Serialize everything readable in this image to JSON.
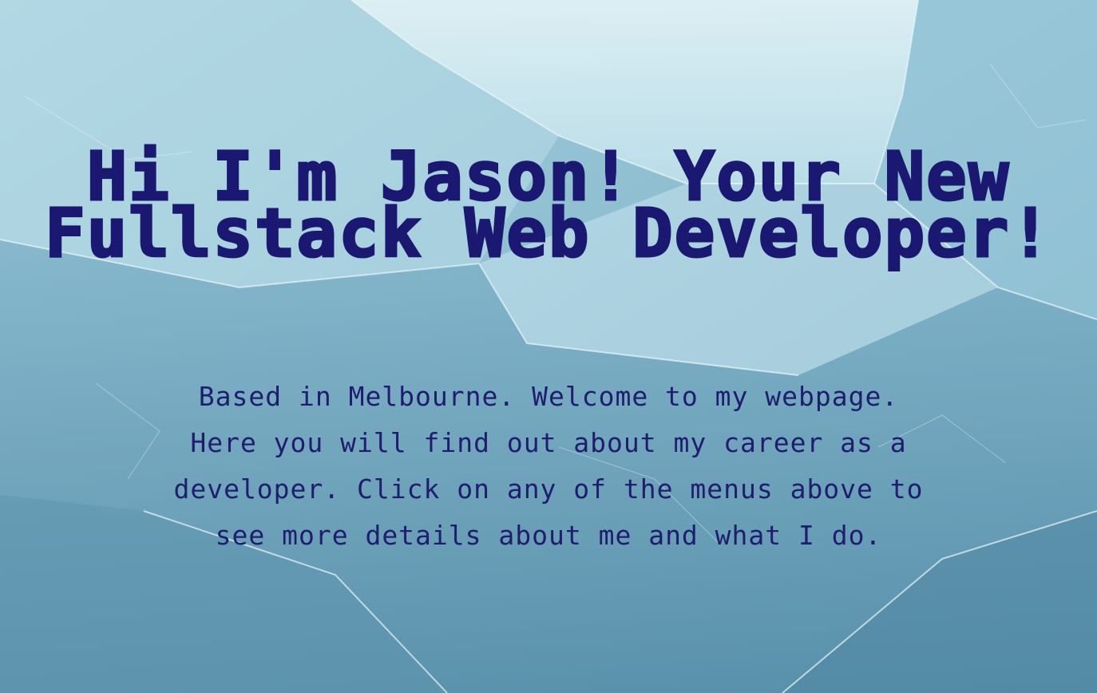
{
  "hero": {
    "headline": "Hi I'm Jason! Your New Fullstack Web Developer!",
    "intro": "Based in Melbourne. Welcome to my webpage. Here you will find out about my career as a developer. Click on any of the menus above to see more details about me and what I do."
  },
  "colors": {
    "text": "#1a1870",
    "background_light": "#d6ecf2",
    "background_dark": "#5b93ae"
  }
}
